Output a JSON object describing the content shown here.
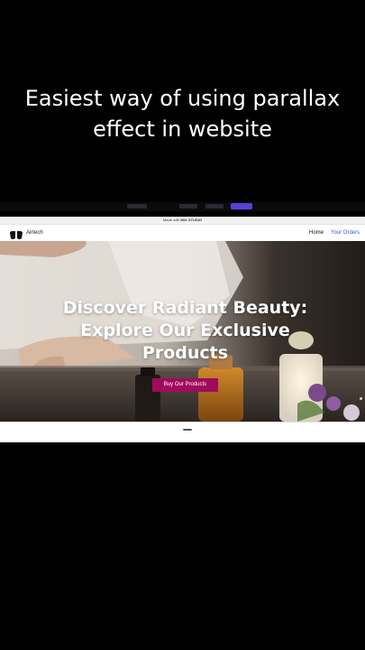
{
  "caption": {
    "line1": "Easiest way of using parallax",
    "line2": "effect in website"
  },
  "banner": {
    "prefix": "Made with",
    "brand": "WIX STUDIO"
  },
  "nav": {
    "brand": "Airtech",
    "home": "Home",
    "orders": "Your Orders"
  },
  "hero": {
    "headline": [
      "Discover Radiant Beauty:",
      "Explore Our Exclusive",
      "Products"
    ],
    "cta": "Buy Our Products"
  },
  "colors": {
    "accent": "#a00b5c",
    "link": "#3b5bd9",
    "toolbar_button": "#5b3fd6"
  },
  "icons": {
    "logo": "logo-icon"
  }
}
